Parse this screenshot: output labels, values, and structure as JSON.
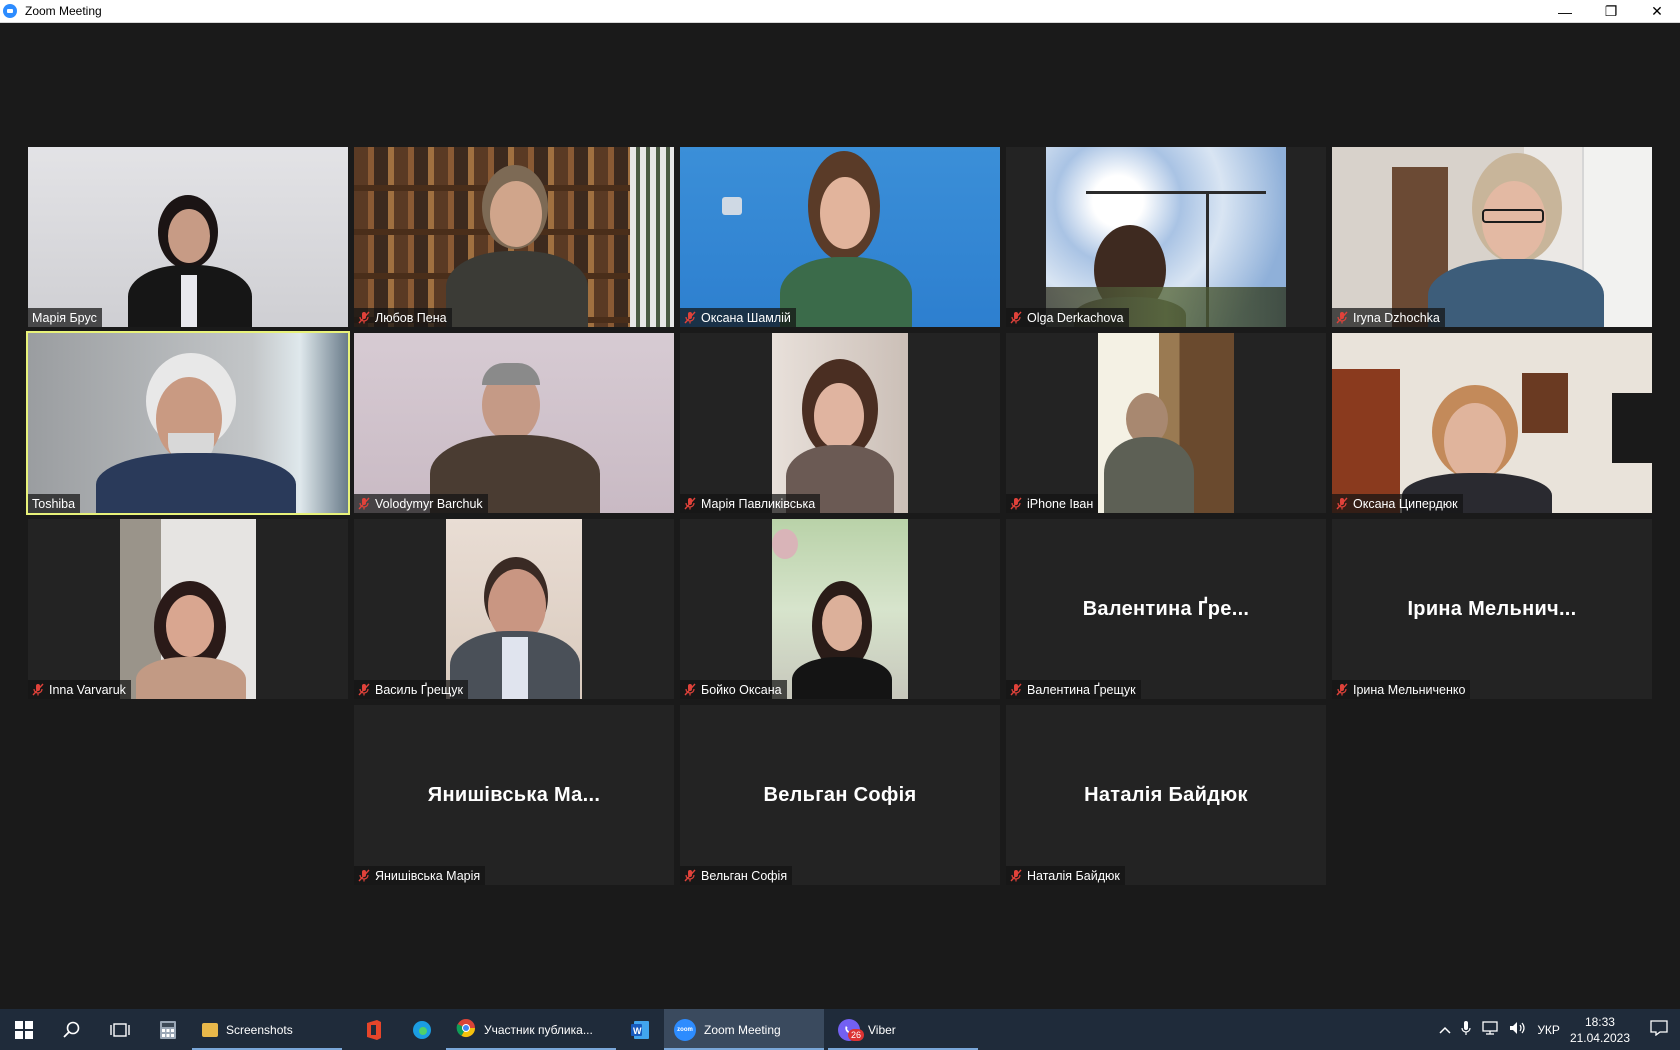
{
  "window": {
    "title": "Zoom Meeting",
    "controls": {
      "minimize": "—",
      "restore": "❐",
      "close": "✕"
    }
  },
  "participants": [
    {
      "name": "Марія Брус",
      "muted": false,
      "active": false,
      "display": "video"
    },
    {
      "name": "Любов Пена",
      "muted": true,
      "active": false,
      "display": "video"
    },
    {
      "name": "Оксана Шамлій",
      "muted": true,
      "active": false,
      "display": "video"
    },
    {
      "name": "Olga Derkachova",
      "muted": true,
      "active": false,
      "display": "video"
    },
    {
      "name": "Iryna Dzhochka",
      "muted": true,
      "active": false,
      "display": "video"
    },
    {
      "name": "Toshiba",
      "muted": false,
      "active": true,
      "display": "video"
    },
    {
      "name": "Volodymyr Barchuk",
      "muted": true,
      "active": false,
      "display": "video"
    },
    {
      "name": "Марія Павликівська",
      "muted": true,
      "active": false,
      "display": "video"
    },
    {
      "name": "iPhone Іван",
      "muted": true,
      "active": false,
      "display": "video"
    },
    {
      "name": "Оксана Ципердюк",
      "muted": true,
      "active": false,
      "display": "video"
    },
    {
      "name": "Inna Varvaruk",
      "muted": true,
      "active": false,
      "display": "video"
    },
    {
      "name": "Василь Ґрещук",
      "muted": true,
      "active": false,
      "display": "video"
    },
    {
      "name": "Бойко Оксана",
      "muted": true,
      "active": false,
      "display": "video"
    },
    {
      "name": "Валентина Ґрещук",
      "muted": true,
      "active": false,
      "display": "name",
      "center_text": "Валентина Ґре..."
    },
    {
      "name": "Ірина Мельниченко",
      "muted": true,
      "active": false,
      "display": "name",
      "center_text": "Ірина  Мельнич..."
    },
    {
      "name": "Янишівська Марія",
      "muted": true,
      "active": false,
      "display": "name",
      "center_text": "Янишівська  Ма..."
    },
    {
      "name": "Вельган Софія",
      "muted": true,
      "active": false,
      "display": "name",
      "center_text": "Вельган Софія"
    },
    {
      "name": "Наталія Байдюк",
      "muted": true,
      "active": false,
      "display": "name",
      "center_text": "Наталія Байдюк"
    }
  ],
  "taskbar": {
    "apps": [
      {
        "label": "Screenshots",
        "active": false
      },
      {
        "label": "Участник публика...",
        "active": false
      },
      {
        "label": "Zoom Meeting",
        "active": true
      },
      {
        "label": "Viber",
        "active": false,
        "badge": "26"
      }
    ],
    "tray": {
      "language": "УКР",
      "time": "18:33",
      "date": "21.04.2023"
    }
  },
  "colors": {
    "active_speaker_border": "#e8f27a",
    "mute_icon": "#e0423a",
    "taskbar_bg": "#1f2b3a",
    "zoom_blue": "#2d8cff"
  }
}
